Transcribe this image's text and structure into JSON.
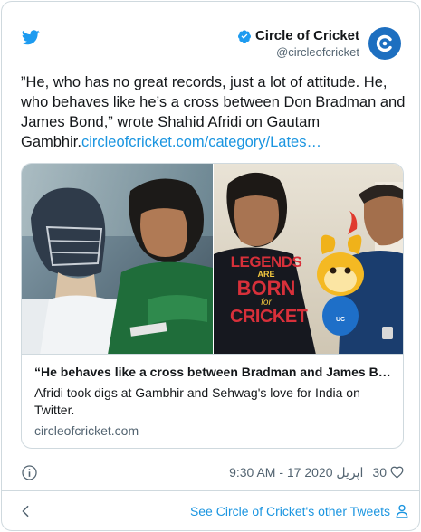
{
  "author": {
    "name": "Circle of Cricket",
    "handle": "@circleofcricket",
    "verified": true
  },
  "tweet": {
    "text": "”He, who has no great records, just a lot of attitude. He, who behaves like he’s a cross between Don Bradman and James Bond,” wrote Shahid Afridi on Gautam Gambhir.",
    "link": "circleofcricket.com/category/Lates…"
  },
  "card": {
    "title": "“He behaves like a cross between Bradman and James Bond”",
    "description": "Afridi took digs at Gambhir and Sehwag's love for India on Twitter.",
    "domain": "circleofcricket.com",
    "shirt_line1": "LEGENDS",
    "shirt_line2": "ARE",
    "shirt_line3": "BORN",
    "shirt_line4": "for",
    "shirt_line5": "CRICKET",
    "toy_badge": "UC"
  },
  "meta": {
    "timestamp": "9:30 AM - 17 اپریل 2020",
    "likes": "30"
  },
  "footer": {
    "see_other": "See Circle of Cricket's other Tweets"
  },
  "colors": {
    "link": "#1b95e0",
    "verified": "#1d9bf0",
    "avatar": "#1d6fc0"
  },
  "icons": [
    "twitter-bird-icon",
    "verified-badge-icon",
    "info-icon",
    "heart-icon",
    "chevron-left-icon",
    "person-icon"
  ]
}
